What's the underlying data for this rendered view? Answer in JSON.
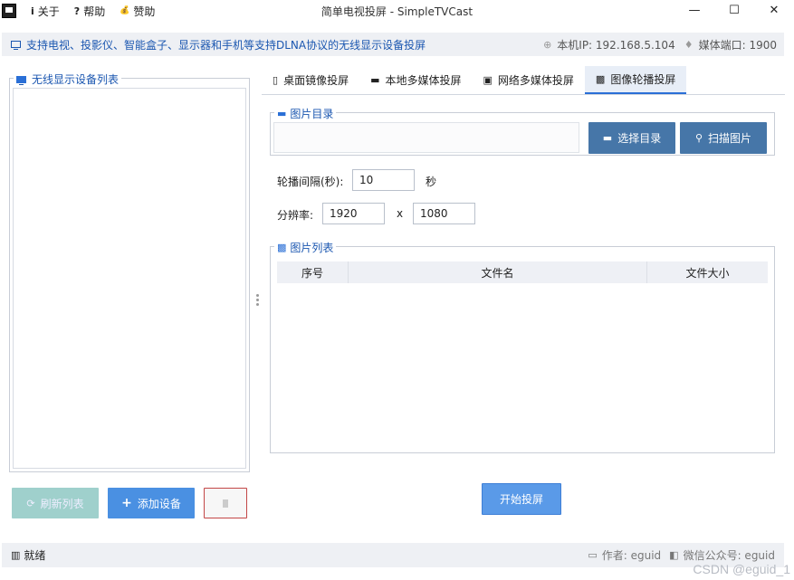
{
  "window": {
    "title": "简单电视投屏 - SimpleTVCast",
    "menu": [
      {
        "icon": "info-icon",
        "glyph": "i",
        "label": "关于"
      },
      {
        "icon": "help-icon",
        "glyph": "?",
        "label": "帮助"
      },
      {
        "icon": "donate-icon",
        "glyph": "💰",
        "label": "赞助"
      }
    ],
    "controls": {
      "minimize": "—",
      "maximize": "☐",
      "close": "✕"
    }
  },
  "infobar": {
    "message": "支持电视、投影仪、智能盒子、显示器和手机等支持DLNA协议的无线显示设备投屏",
    "local_ip": "本机IP: 192.168.5.104",
    "media_port": "媒体端口: 1900"
  },
  "left_panel": {
    "title": "无线显示设备列表",
    "refresh_label": "刷新列表",
    "add_label": "添加设备"
  },
  "tabs": [
    {
      "label": "桌面镜像投屏",
      "icon": "phone-icon",
      "active": false
    },
    {
      "label": "本地多媒体投屏",
      "icon": "clapper-icon",
      "active": false
    },
    {
      "label": "网络多媒体投屏",
      "icon": "network-media-icon",
      "active": false
    },
    {
      "label": "图像轮播投屏",
      "icon": "image-icon",
      "active": true
    }
  ],
  "image_dir": {
    "legend": "图片目录",
    "value": "",
    "choose_label": "选择目录",
    "scan_label": "扫描图片"
  },
  "settings": {
    "interval_label": "轮播间隔(秒):",
    "interval_value": "10",
    "interval_unit": "秒",
    "resolution_label": "分辨率:",
    "width": "1920",
    "height": "1080",
    "separator": "x"
  },
  "image_list": {
    "legend": "图片列表",
    "columns": [
      "序号",
      "文件名",
      "文件大小"
    ]
  },
  "start_label": "开始投屏",
  "status": {
    "text": "就绪",
    "author": "作者: eguid",
    "wechat": "微信公众号: eguid"
  },
  "watermark": "CSDN @eguid_1",
  "colors": {
    "accent": "#4a90e2",
    "button_dark": "#4676a8",
    "link_blue": "#1a56b0"
  }
}
